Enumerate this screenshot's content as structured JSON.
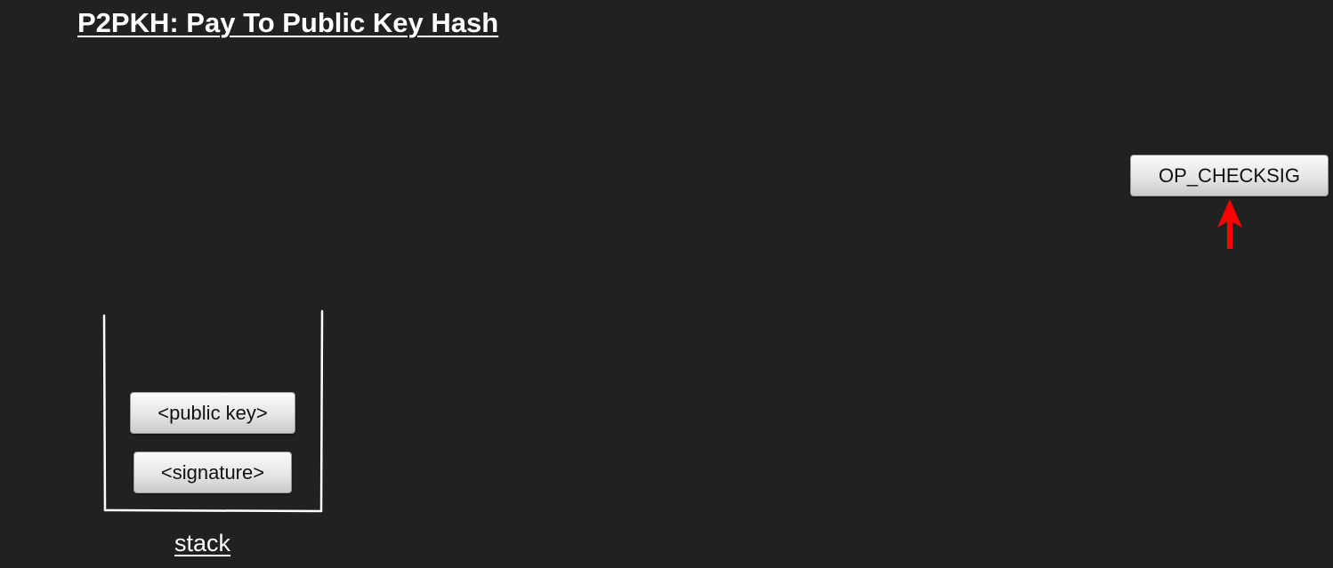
{
  "title": "P2PKH: Pay To Public Key Hash",
  "current_opcode": "OP_CHECKSIG",
  "stack": {
    "label": "stack",
    "items_top_to_bottom": [
      "<public key>",
      "<signature>"
    ]
  },
  "colors": {
    "background": "#212121",
    "text": "#ffffff",
    "pointer_arrow": "#ff0000",
    "token_fill": "#e6e6e6"
  },
  "icons": {
    "pointer": "up-arrow-icon"
  }
}
